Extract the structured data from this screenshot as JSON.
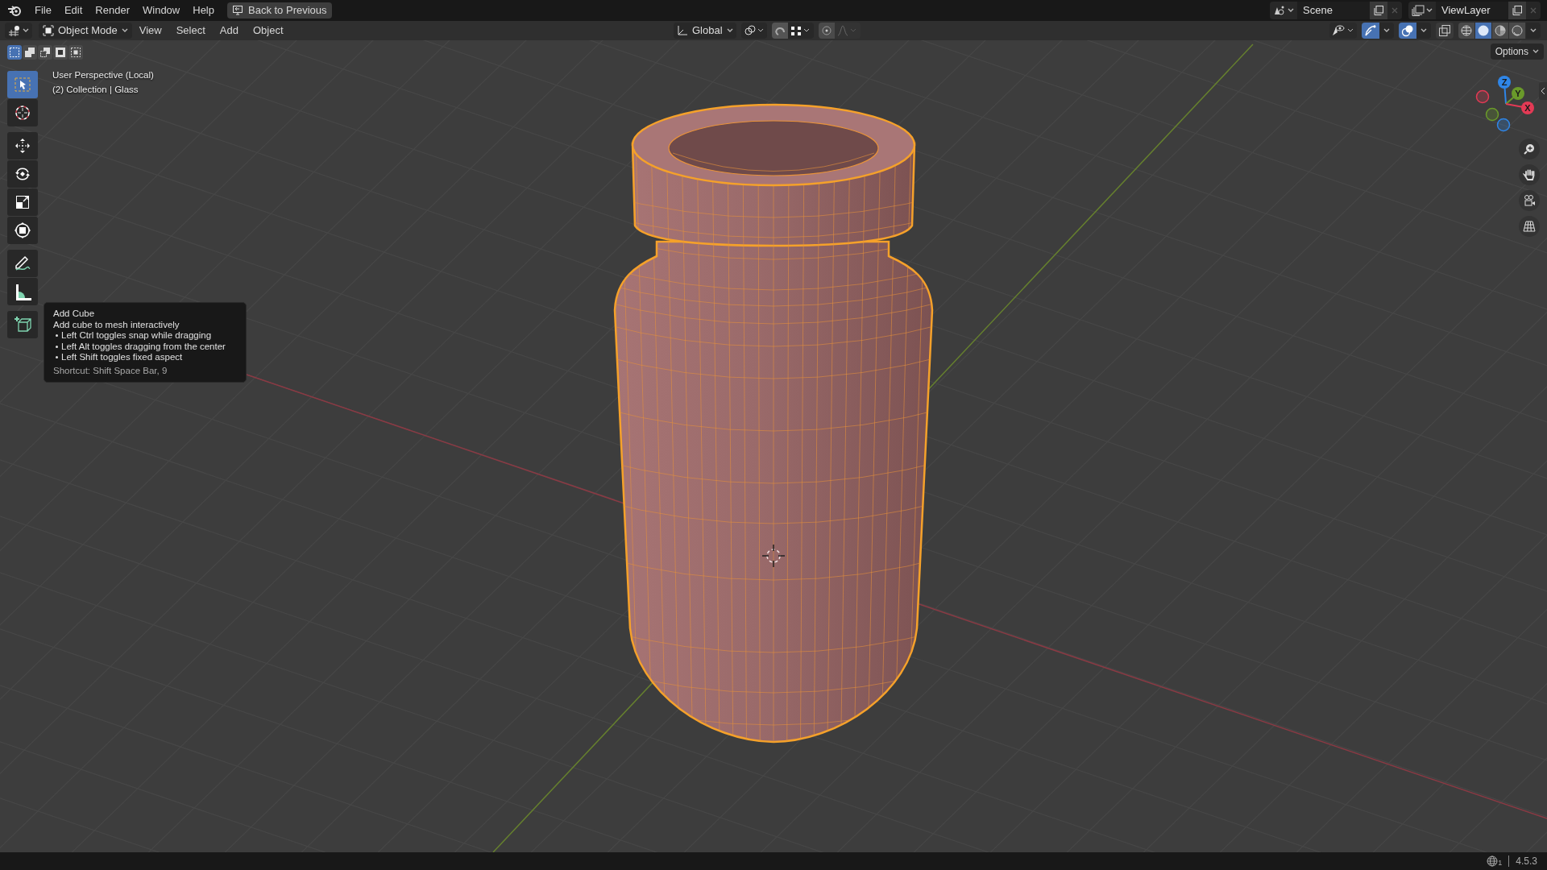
{
  "top_bar": {
    "menus": [
      "File",
      "Edit",
      "Render",
      "Window",
      "Help"
    ],
    "back_button": "Back to Previous",
    "scene": "Scene",
    "view_layer": "ViewLayer"
  },
  "header": {
    "mode": "Object Mode",
    "menus": [
      "View",
      "Select",
      "Add",
      "Object"
    ],
    "transform_orientation": "Global",
    "toggles": [
      {
        "kind": "gizmo",
        "on": true
      },
      {
        "kind": "overlay",
        "on": true
      },
      {
        "kind": "xray",
        "on": false
      }
    ],
    "shading": [
      {
        "kind": "wireframe",
        "selected": false
      },
      {
        "kind": "solid",
        "selected": true
      },
      {
        "kind": "material",
        "selected": false
      },
      {
        "kind": "rendered",
        "selected": false
      }
    ],
    "options": "Options"
  },
  "select_modes": [
    {
      "kind": "set",
      "selected": true
    },
    {
      "kind": "extend",
      "selected": false
    },
    {
      "kind": "subtract",
      "selected": false
    },
    {
      "kind": "invert",
      "selected": false
    },
    {
      "kind": "intersect",
      "selected": false
    }
  ],
  "viewport": {
    "info": [
      "User Perspective (Local)",
      "(2) Collection | Glass"
    ],
    "tools": [
      {
        "kind": "select_box",
        "selected": true
      },
      {
        "kind": "cursor",
        "selected": false
      },
      {
        "kind": "move",
        "selected": false
      },
      {
        "kind": "rotate",
        "selected": false
      },
      {
        "kind": "scale",
        "selected": false
      },
      {
        "kind": "transform",
        "selected": false
      },
      {
        "kind": "annotate",
        "selected": false
      },
      {
        "kind": "measure",
        "selected": false
      },
      {
        "kind": "add_cube",
        "selected": false
      }
    ],
    "tooltip": {
      "title": "Add Cube",
      "description": "Add cube to mesh interactively",
      "hints": [
        "Left Ctrl toggles snap while dragging",
        "Left Alt toggles dragging from the center",
        "Left Shift toggles fixed aspect"
      ],
      "shortcut": "Shortcut: Shift Space Bar, 9"
    },
    "gizmo_axes": [
      {
        "kind": "z",
        "label": "Z"
      },
      {
        "kind": "y",
        "label": "Y"
      },
      {
        "kind": "x",
        "label": "X"
      }
    ]
  },
  "status_bar": {
    "count": "1",
    "version": "4.5.3"
  }
}
